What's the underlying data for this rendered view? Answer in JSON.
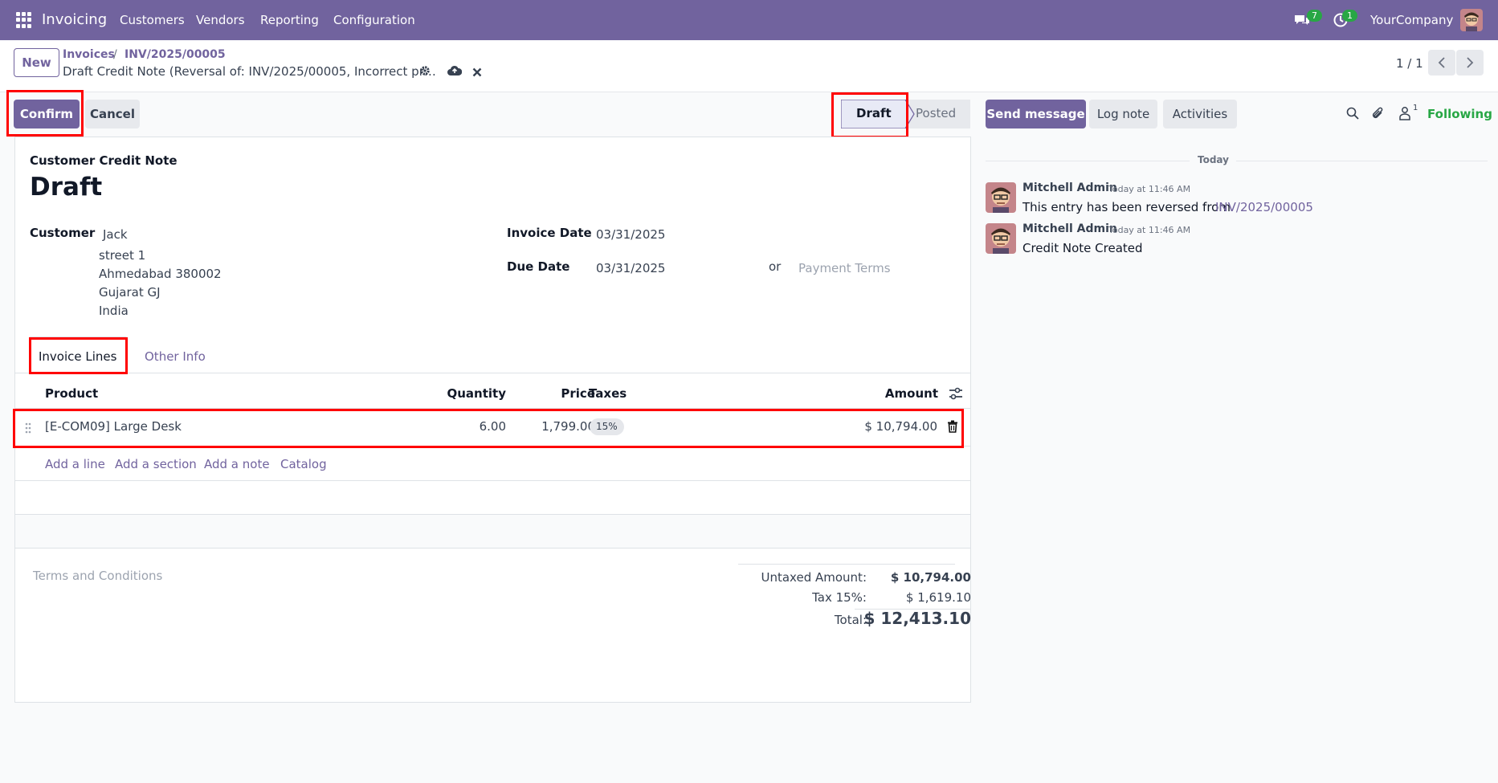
{
  "topbar": {
    "app_name": "Invoicing",
    "menu": [
      "Customers",
      "Vendors",
      "Reporting",
      "Configuration"
    ],
    "messages_badge": "7",
    "activities_badge": "1",
    "company": "YourCompany",
    "bg_color": "#71639e"
  },
  "control_panel": {
    "new_label": "New",
    "breadcrumb_parent": "Invoices",
    "breadcrumb_separator": "/",
    "breadcrumb_record": "INV/2025/00005",
    "record_title": "Draft Credit Note (Reversal of: INV/2025/00005, Incorrect pr…",
    "pager": "1 / 1"
  },
  "actions": {
    "confirm_label": "Confirm",
    "cancel_label": "Cancel"
  },
  "statusbar": {
    "draft_label": "Draft",
    "posted_label": "Posted",
    "current": "Draft"
  },
  "form": {
    "document_type": "Customer Credit Note",
    "state_title": "Draft",
    "customer_label": "Customer",
    "customer_name": "Jack",
    "address": [
      "street 1",
      "Ahmedabad 380002",
      "Gujarat GJ",
      "India"
    ],
    "invoice_date_label": "Invoice Date",
    "invoice_date": "03/31/2025",
    "due_date_label": "Due Date",
    "due_date": "03/31/2025",
    "or_label": "or",
    "payment_terms_placeholder": "Payment Terms",
    "tabs": [
      "Invoice Lines",
      "Other Info"
    ],
    "active_tab": "Invoice Lines",
    "columns": {
      "product": "Product",
      "quantity": "Quantity",
      "price": "Price",
      "taxes": "Taxes",
      "amount": "Amount"
    },
    "lines": [
      {
        "product": "[E-COM09] Large Desk",
        "quantity": "6.00",
        "price": "1,799.00",
        "tax": "15%",
        "amount": "$ 10,794.00"
      }
    ],
    "add_links": [
      "Add a line",
      "Add a section",
      "Add a note",
      "Catalog"
    ],
    "terms_placeholder": "Terms and Conditions",
    "totals": {
      "untaxed_label": "Untaxed Amount:",
      "untaxed_value": "$ 10,794.00",
      "tax_label": "Tax 15%:",
      "tax_value": "$ 1,619.10",
      "total_label": "Total:",
      "total_value": "$ 12,413.10"
    }
  },
  "chatter": {
    "send_message_label": "Send message",
    "log_note_label": "Log note",
    "activities_label": "Activities",
    "followers_count": "1",
    "following_label": "Following",
    "date_separator": "Today",
    "messages": [
      {
        "author": "Mitchell Admin",
        "time": "Today at 11:46 AM",
        "text": "This entry has been reversed from",
        "link": "INV/2025/00005"
      },
      {
        "author": "Mitchell Admin",
        "time": "Today at 11:46 AM",
        "text": "Credit Note Created",
        "link": ""
      }
    ]
  },
  "colors": {
    "primary": "#71639e",
    "highlight_box": "#ff0000",
    "following": "#28a745"
  }
}
